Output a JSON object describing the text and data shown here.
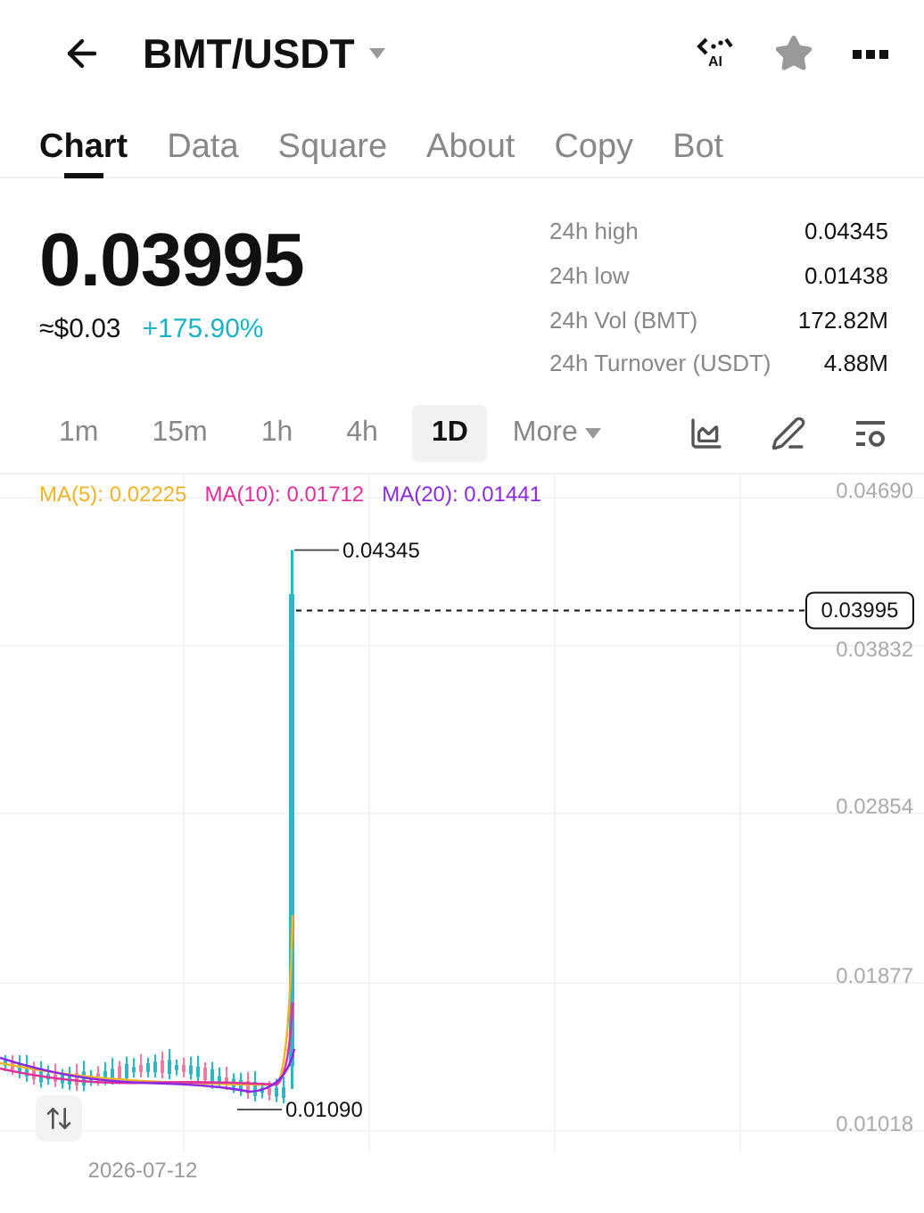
{
  "header": {
    "pair": "BMT/USDT",
    "ai_badge": "AI"
  },
  "tabs": [
    {
      "label": "Chart",
      "selected": true
    },
    {
      "label": "Data",
      "selected": false
    },
    {
      "label": "Square",
      "selected": false
    },
    {
      "label": "About",
      "selected": false
    },
    {
      "label": "Copy",
      "selected": false
    },
    {
      "label": "Bot",
      "selected": false
    }
  ],
  "price": {
    "last": "0.03995",
    "fiat": "≈$0.03",
    "change": "+175.90%"
  },
  "stats": [
    {
      "label": "24h high",
      "value": "0.04345"
    },
    {
      "label": "24h low",
      "value": "0.01438"
    },
    {
      "label": "24h Vol (BMT)",
      "value": "172.82M"
    },
    {
      "label": "24h Turnover (USDT)",
      "value": "4.88M"
    }
  ],
  "intervals": [
    {
      "label": "1m",
      "selected": false
    },
    {
      "label": "15m",
      "selected": false
    },
    {
      "label": "1h",
      "selected": false
    },
    {
      "label": "4h",
      "selected": false
    },
    {
      "label": "1D",
      "selected": true
    }
  ],
  "more": "More",
  "chart": {
    "moving_averages": [
      {
        "label": "MA(5): 0.02225",
        "color": "#f0b429"
      },
      {
        "label": "MA(10): 0.01712",
        "color": "#e0309a"
      },
      {
        "label": "MA(20): 0.01441",
        "color": "#8a2be2"
      }
    ],
    "y_ticks": [
      "0.04690",
      "0.03832",
      "0.02854",
      "0.01877",
      "0.01018"
    ],
    "high_marker": "0.04345",
    "low_marker": "0.01090",
    "last_price": "0.03995",
    "date_label": "2026-07-12"
  }
}
